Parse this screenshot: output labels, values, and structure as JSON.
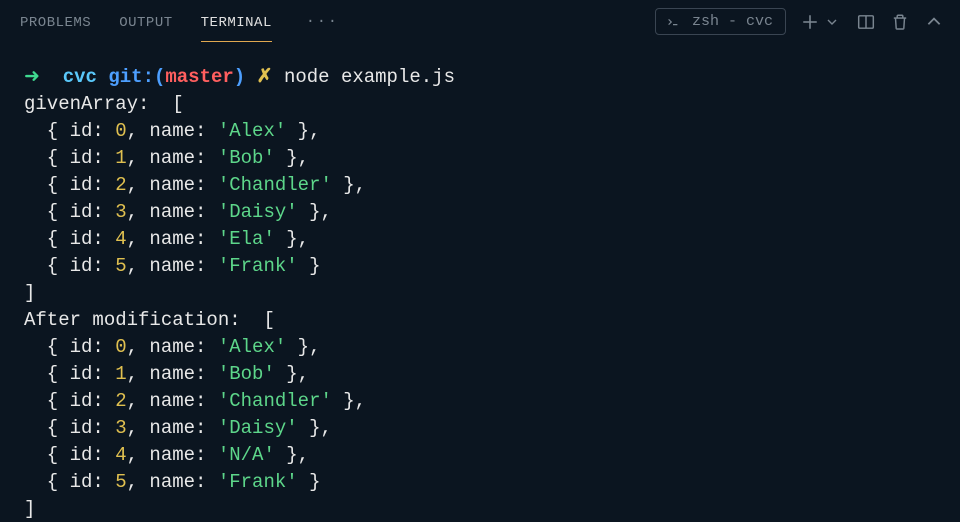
{
  "tabs": {
    "problems": "PROBLEMS",
    "output": "OUTPUT",
    "terminal": "TERMINAL",
    "more": "···"
  },
  "shell": {
    "label": "zsh - cvc"
  },
  "prompt": {
    "arrow": "➜",
    "cwd": "cvc",
    "git_label": "git:",
    "branch_open": "(",
    "branch": "master",
    "branch_close": ")",
    "dirty": "✗",
    "command": "node example.js"
  },
  "output": {
    "label1": "givenArray:  [",
    "label2": "After modification:  [",
    "close": "]",
    "arrays": {
      "a": [
        {
          "id": 0,
          "name": "Alex"
        },
        {
          "id": 1,
          "name": "Bob"
        },
        {
          "id": 2,
          "name": "Chandler"
        },
        {
          "id": 3,
          "name": "Daisy"
        },
        {
          "id": 4,
          "name": "Ela"
        },
        {
          "id": 5,
          "name": "Frank"
        }
      ],
      "b": [
        {
          "id": 0,
          "name": "Alex"
        },
        {
          "id": 1,
          "name": "Bob"
        },
        {
          "id": 2,
          "name": "Chandler"
        },
        {
          "id": 3,
          "name": "Daisy"
        },
        {
          "id": 4,
          "name": "N/A"
        },
        {
          "id": 5,
          "name": "Frank"
        }
      ]
    }
  }
}
